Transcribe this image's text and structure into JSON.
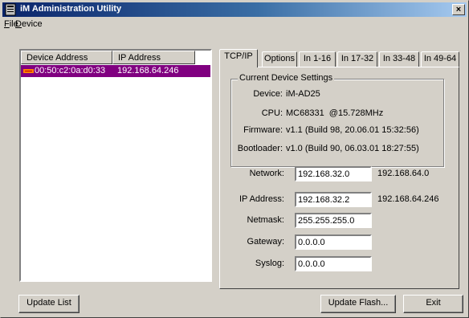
{
  "window": {
    "title": "iM Administration Utility",
    "close_glyph": "×"
  },
  "menu": {
    "file": "File",
    "device": "Device"
  },
  "list": {
    "columns": [
      "Device Address",
      "IP Address"
    ],
    "rows": [
      {
        "mac": "00:50:c2:0a:d0:33",
        "ip": "192.168.64.246"
      }
    ],
    "selection_color": "#800080"
  },
  "tabs": [
    "TCP/IP",
    "Options",
    "In 1-16",
    "In 17-32",
    "In 33-48",
    "In 49-64"
  ],
  "current": {
    "group_title": "Current Device Settings",
    "device_label": "Device:",
    "device": "iM-AD25",
    "cpu_label": "CPU:",
    "cpu": "MC68331  @15.728MHz",
    "firmware_label": "Firmware:",
    "firmware": "v1.1 (Build 98, 20.06.01 15:32:56)",
    "bootloader_label": "Bootloader:",
    "bootloader": "v1.0 (Build 90, 06.03.01 18:27:55)"
  },
  "fields": {
    "network_label": "Network:",
    "network": "192.168.32.0",
    "network_current": "192.168.64.0",
    "ip_label": "IP Address:",
    "ip": "192.168.32.2",
    "ip_current": "192.168.64.246",
    "netmask_label": "Netmask:",
    "netmask": "255.255.255.0",
    "gateway_label": "Gateway:",
    "gateway": "0.0.0.0",
    "syslog_label": "Syslog:",
    "syslog": "0.0.0.0"
  },
  "buttons": {
    "update_list": "Update List",
    "update_flash": "Update Flash...",
    "exit": "Exit"
  }
}
